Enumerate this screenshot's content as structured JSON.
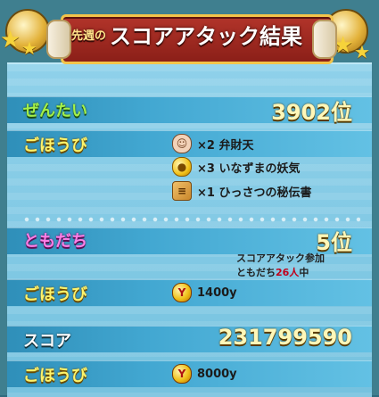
{
  "header": {
    "prefix": "先週の",
    "title": "スコアアタック結果"
  },
  "overall": {
    "label": "ぜんたい",
    "rank": "3902位"
  },
  "overall_rewards": {
    "label": "ごほうび",
    "items": [
      {
        "icon": "character-icon",
        "text": "×2 弁財天"
      },
      {
        "icon": "orb-icon",
        "text": "×3 いなずまの妖気"
      },
      {
        "icon": "scroll-icon",
        "text": "×1 ひっさつの秘伝書"
      }
    ]
  },
  "friends": {
    "label": "ともだち",
    "rank": "5位",
    "info_line1": "スコアアタック参加",
    "info_line2_prefix": "ともだち",
    "info_line2_count": "26人",
    "info_line2_suffix": "中"
  },
  "friends_rewards": {
    "label": "ごほうび",
    "coin_text": "1400y"
  },
  "score": {
    "label": "スコア",
    "value": "231799590"
  },
  "score_rewards": {
    "label": "ごほうび",
    "coin_text": "8000y"
  },
  "colors": {
    "stripe": "#43a8d2",
    "panel": "#8fd1ea",
    "header_red": "#b2342a",
    "gold": "#f3c44a"
  }
}
